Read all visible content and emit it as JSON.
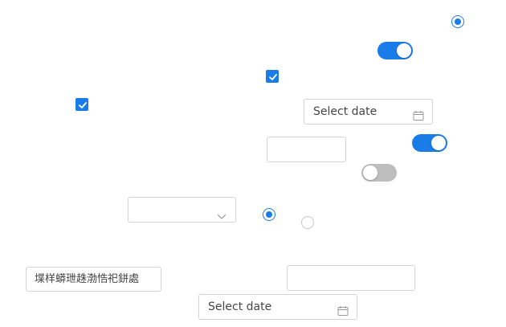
{
  "radios": [
    {
      "id": "radio-top-right",
      "checked": true
    },
    {
      "id": "radio-middle-1",
      "checked": true
    },
    {
      "id": "radio-middle-2",
      "checked": false
    }
  ],
  "checkboxes": [
    {
      "id": "checkbox-1",
      "checked": true
    },
    {
      "id": "checkbox-2",
      "checked": true
    }
  ],
  "toggles": [
    {
      "id": "toggle-1",
      "on": true
    },
    {
      "id": "toggle-2",
      "on": true
    },
    {
      "id": "toggle-3",
      "on": false
    }
  ],
  "date_pickers": [
    {
      "placeholder": "Select date"
    },
    {
      "placeholder": "Select date"
    }
  ],
  "text_fields": [
    {
      "value": ""
    },
    {
      "value": "堞样蟒玴趎渤悎祀鉼處"
    },
    {
      "value": ""
    }
  ],
  "select": {
    "value": ""
  },
  "icons": {
    "calendar": "calendar-icon",
    "chevron": "chevron-down-icon",
    "check": "check-icon"
  },
  "colors": {
    "accent": "#1a7ce8",
    "toggle_off": "#bdbdbd",
    "border": "#d3d3d3"
  }
}
